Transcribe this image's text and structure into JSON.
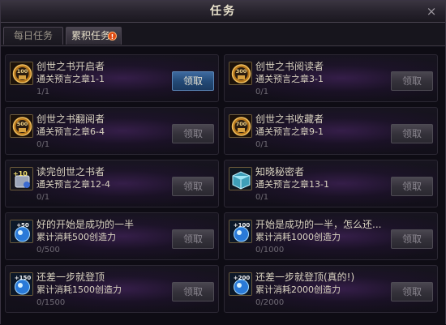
{
  "window": {
    "title": "任务",
    "close_glyph": "×"
  },
  "tabs": [
    {
      "label": "每日任务",
      "selected": false
    },
    {
      "label": "累积任务",
      "selected": true,
      "badge": "!"
    }
  ],
  "tasks": [
    {
      "name": "创世之书开启者",
      "condition": "通关预言之章1-1",
      "progress": "1/1",
      "button": "领取",
      "button_enabled": true,
      "icon": "bronze-medal-icon",
      "icon_text": "100"
    },
    {
      "name": "创世之书阅读者",
      "condition": "通关预言之章3-1",
      "progress": "0/1",
      "button": "领取",
      "button_enabled": false,
      "icon": "bronze-medal-icon",
      "icon_text": "300"
    },
    {
      "name": "创世之书翻阅者",
      "condition": "通关预言之章6-4",
      "progress": "0/1",
      "button": "领取",
      "button_enabled": false,
      "icon": "bronze-medal-icon",
      "icon_text": "500"
    },
    {
      "name": "创世之书收藏者",
      "condition": "通关预言之章9-1",
      "progress": "0/1",
      "button": "领取",
      "button_enabled": false,
      "icon": "bronze-medal-icon",
      "icon_text": "700"
    },
    {
      "name": "读完创世之书者",
      "condition": "通关预言之章12-4",
      "progress": "0/1",
      "button": "领取",
      "button_enabled": false,
      "icon": "enhance-scroll-icon",
      "icon_text": "+10"
    },
    {
      "name": "知晓秘密者",
      "condition": "通关预言之章13-1",
      "progress": "0/1",
      "button": "领取",
      "button_enabled": false,
      "icon": "crystal-box-icon",
      "icon_text": ""
    },
    {
      "name": "好的开始是成功的一半",
      "condition": "累计消耗500创造力",
      "progress": "0/500",
      "button": "领取",
      "button_enabled": false,
      "icon": "blue-potion-icon",
      "icon_text": "+50"
    },
    {
      "name": "开始是成功的一半，怎么还...",
      "condition": "累计消耗1000创造力",
      "progress": "0/1000",
      "button": "领取",
      "button_enabled": false,
      "icon": "blue-potion-icon",
      "icon_text": "+100"
    },
    {
      "name": "还差一步就登顶",
      "condition": "累计消耗1500创造力",
      "progress": "0/1500",
      "button": "领取",
      "button_enabled": false,
      "icon": "blue-potion-icon",
      "icon_text": "+150"
    },
    {
      "name": "还差一步就登顶(真的!)",
      "condition": "累计消耗2000创造力",
      "progress": "0/2000",
      "button": "领取",
      "button_enabled": false,
      "icon": "blue-potion-icon",
      "icon_text": "+200"
    }
  ],
  "colors": {
    "active_button": "#2e5c93",
    "disabled_button": "#3b3842",
    "card_glow": "#4a2a6a",
    "medal": "#c8861e",
    "badge": "#e04a12"
  }
}
